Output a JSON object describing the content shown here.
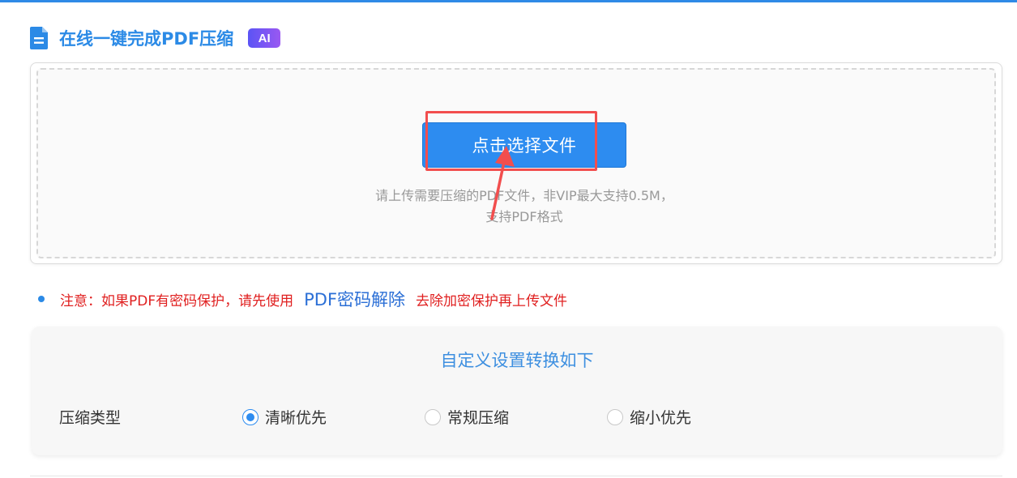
{
  "header": {
    "title": "在线一键完成PDF压缩",
    "badge": "AI"
  },
  "upload": {
    "button_label": "点击选择文件",
    "hint_line1": "请上传需要压缩的PDF文件，非VIP最大支持0.5M，",
    "hint_line2": "支持PDF格式"
  },
  "notice": {
    "prefix": "注意：如果PDF有密码保护，请先使用",
    "link": "PDF密码解除",
    "suffix": "去除加密保护再上传文件"
  },
  "settings": {
    "title": "自定义设置转换如下",
    "type_label": "压缩类型",
    "options": [
      {
        "label": "清晰优先",
        "checked": true
      },
      {
        "label": "常规压缩",
        "checked": false
      },
      {
        "label": "缩小优先",
        "checked": false
      }
    ]
  },
  "colors": {
    "accent": "#2b8ae6",
    "button": "#2d8cf0",
    "warning": "#e02020",
    "annotation": "#f24e4e"
  }
}
